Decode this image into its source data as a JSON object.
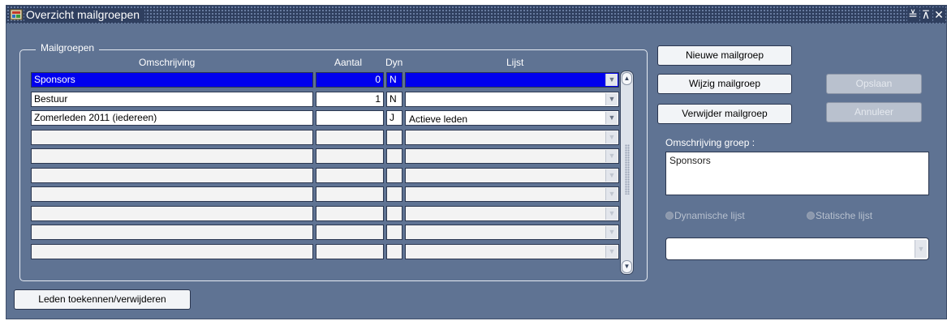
{
  "window": {
    "title": "Overzicht mailgroepen",
    "controls": {
      "minimize": "≚",
      "maximize": "⊼",
      "close": "✕"
    }
  },
  "mailgroups": {
    "frame_title": "Mailgroepen",
    "columns": {
      "omschrijving": "Omschrijving",
      "aantal": "Aantal",
      "dyn": "Dyn",
      "lijst": "Lijst"
    },
    "rows": [
      {
        "omschrijving": "Sponsors",
        "aantal": "0",
        "dyn": "N",
        "lijst": "",
        "selected": true
      },
      {
        "omschrijving": "Bestuur",
        "aantal": "1",
        "dyn": "N",
        "lijst": ""
      },
      {
        "omschrijving": "Zomerleden 2011 (iedereen)",
        "aantal": "",
        "dyn": "J",
        "lijst": "Actieve leden"
      },
      {
        "omschrijving": "",
        "aantal": "",
        "dyn": "",
        "lijst": ""
      },
      {
        "omschrijving": "",
        "aantal": "",
        "dyn": "",
        "lijst": ""
      },
      {
        "omschrijving": "",
        "aantal": "",
        "dyn": "",
        "lijst": ""
      },
      {
        "omschrijving": "",
        "aantal": "",
        "dyn": "",
        "lijst": ""
      },
      {
        "omschrijving": "",
        "aantal": "",
        "dyn": "",
        "lijst": ""
      },
      {
        "omschrijving": "",
        "aantal": "",
        "dyn": "",
        "lijst": ""
      },
      {
        "omschrijving": "",
        "aantal": "",
        "dyn": "",
        "lijst": ""
      }
    ]
  },
  "buttons": {
    "new_group": "Nieuwe mailgroep",
    "edit_group": "Wijzig mailgroep",
    "delete_group": "Verwijder mailgroep",
    "save": "Opslaan",
    "cancel": "Annuleer",
    "assign_members": "Leden toekennen/verwijderen"
  },
  "detail": {
    "label": "Omschrijving groep :",
    "value": "Sponsors",
    "radio_dynamic": "Dynamische lijst",
    "radio_static": "Statische lijst",
    "list_value": ""
  },
  "colors": {
    "background": "#5f7393",
    "titlebar": "#2f3f5f",
    "selection": "#0000ee"
  }
}
